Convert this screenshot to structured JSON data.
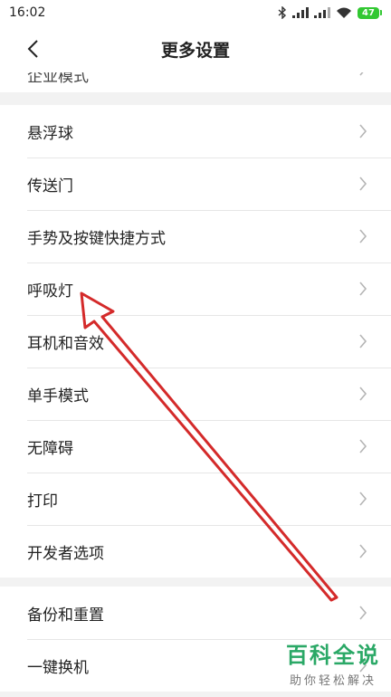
{
  "status_bar": {
    "time": "16:02",
    "battery": "47"
  },
  "header": {
    "title": "更多设置"
  },
  "cut_item": {
    "label": "企业模式"
  },
  "group1": {
    "items": [
      {
        "label": "悬浮球"
      },
      {
        "label": "传送门"
      },
      {
        "label": "手势及按键快捷方式"
      },
      {
        "label": "呼吸灯"
      },
      {
        "label": "耳机和音效"
      },
      {
        "label": "单手模式"
      },
      {
        "label": "无障碍"
      },
      {
        "label": "打印"
      },
      {
        "label": "开发者选项"
      }
    ]
  },
  "group2": {
    "items": [
      {
        "label": "备份和重置"
      },
      {
        "label": "一键换机"
      }
    ]
  },
  "watermark": {
    "main": "百科全说",
    "sub": "助你轻松解决"
  },
  "colors": {
    "annotation_arrow": "#d42a2a",
    "battery": "#32c832",
    "watermark": "#2aa866"
  }
}
